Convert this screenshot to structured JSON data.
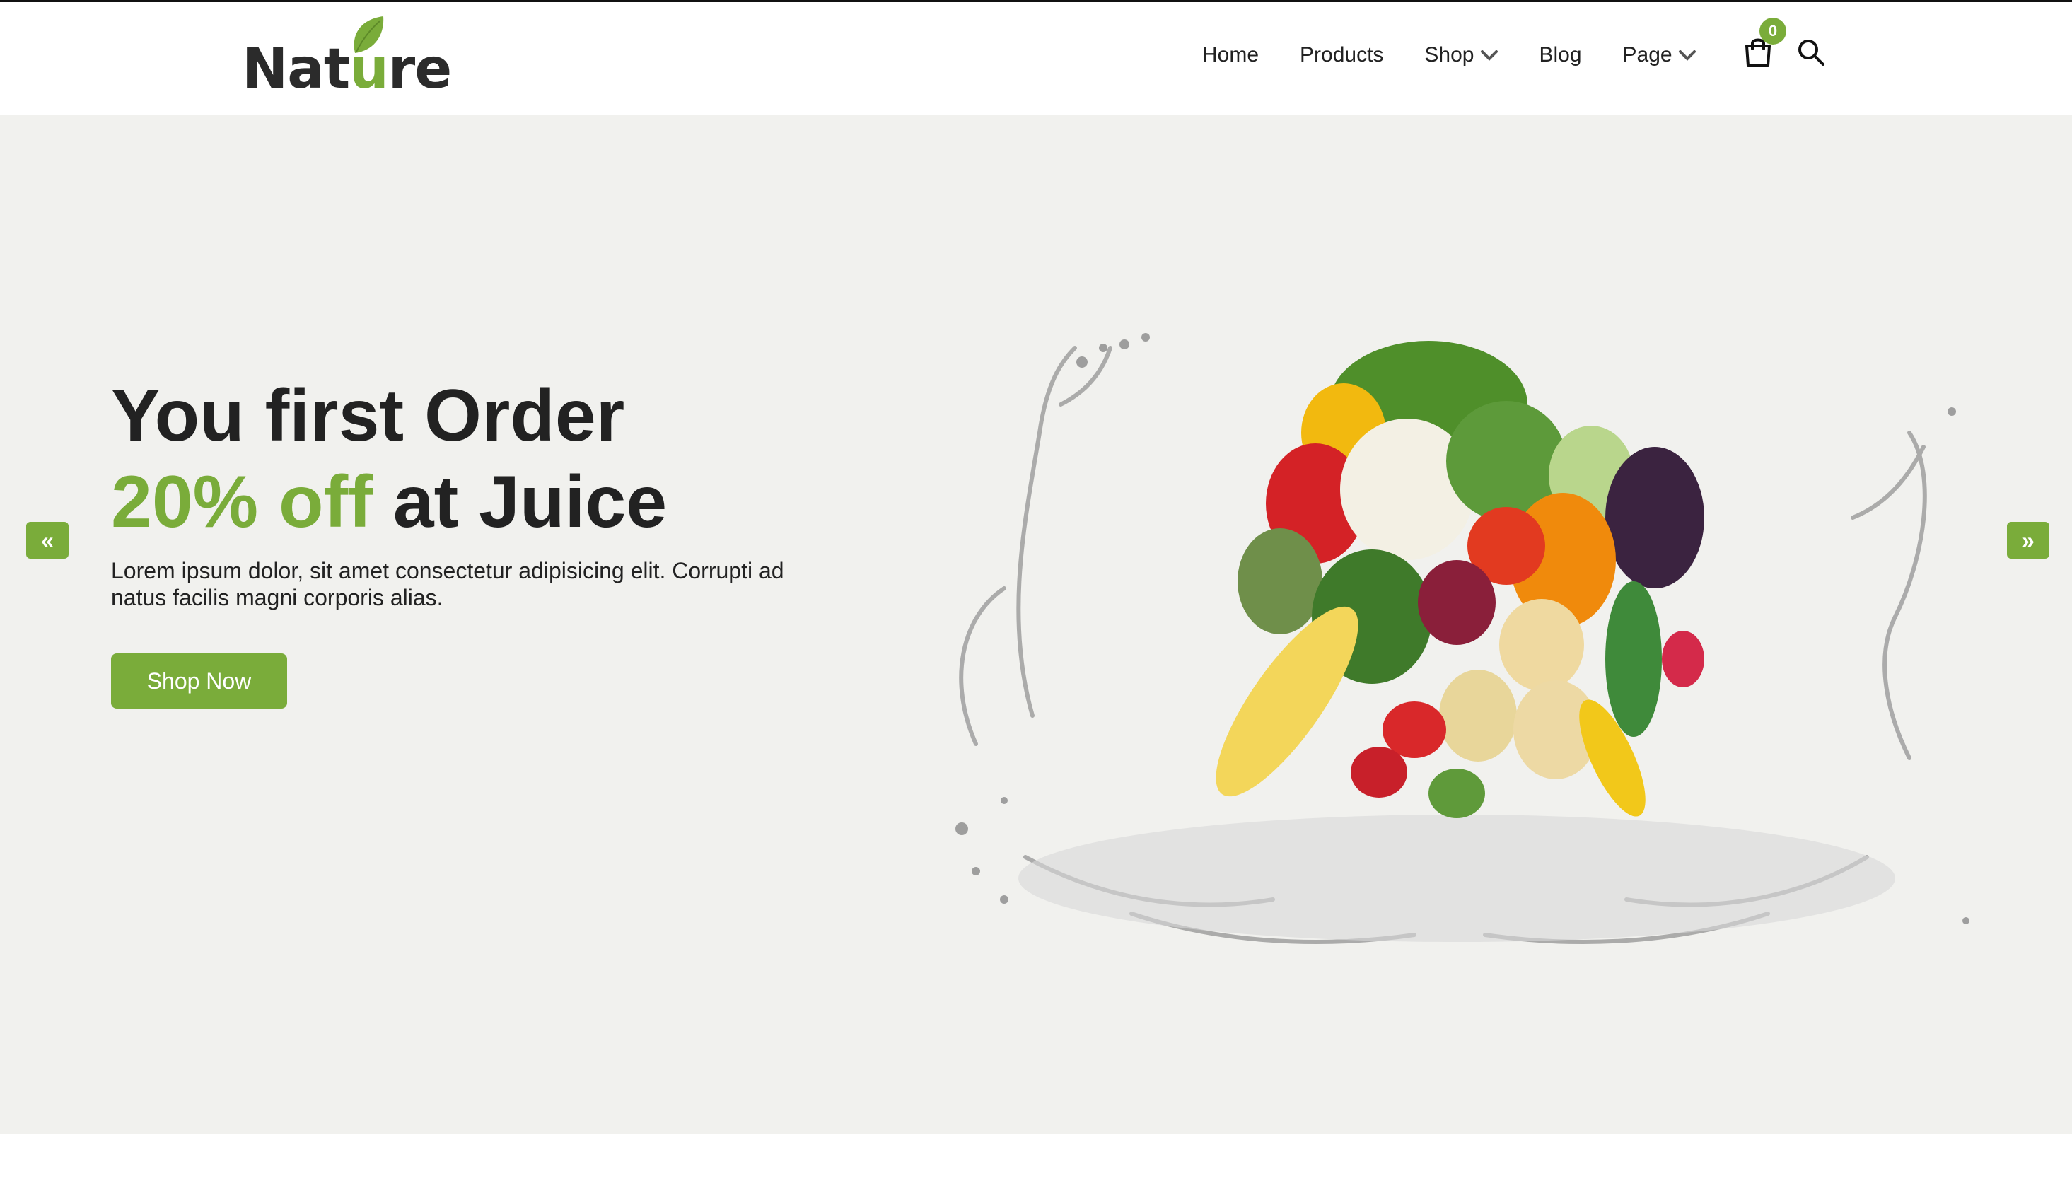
{
  "logo": {
    "text_before": "Nat",
    "text_accent": "u",
    "text_after": "re"
  },
  "nav": {
    "items": [
      {
        "label": "Home",
        "has_dropdown": false
      },
      {
        "label": "Products",
        "has_dropdown": false
      },
      {
        "label": "Shop",
        "has_dropdown": true
      },
      {
        "label": "Blog",
        "has_dropdown": false
      },
      {
        "label": "Page",
        "has_dropdown": true
      }
    ],
    "cart_count": "0",
    "cart_icon": "shopping-bag-icon",
    "search_icon": "search-icon"
  },
  "hero": {
    "title_line1": "You first Order",
    "title_accent": "20% off",
    "title_rest": " at Juice",
    "description": "Lorem ipsum dolor, sit amet consectetur adipisicing elit. Corrupti ad natus facilis magni corporis alias.",
    "button_label": "Shop Now",
    "prev_label": "«",
    "next_label": "»"
  },
  "colors": {
    "accent": "#7aac3a",
    "hero_bg": "#f1f1ee",
    "text": "#222222"
  }
}
